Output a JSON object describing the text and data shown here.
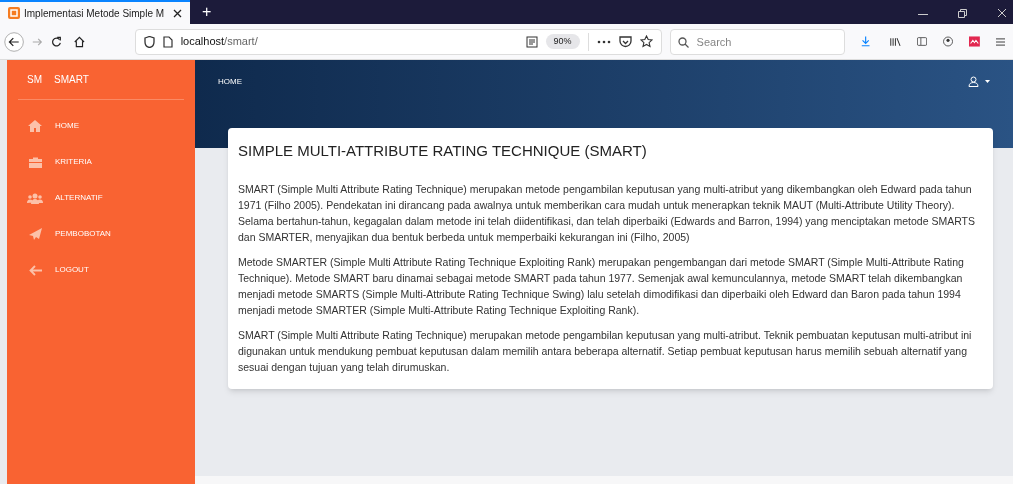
{
  "browser": {
    "tab_title": "Implementasi Metode Simple M",
    "new_tab": "+",
    "url_host": "localhost",
    "url_path": "/smart/",
    "zoom": "90%",
    "search_placeholder": "Search"
  },
  "sidebar": {
    "logo_mini": "SM",
    "logo_text": "SMART",
    "items": [
      {
        "label": "HOME",
        "kind": "home"
      },
      {
        "label": "KRITERIA",
        "kind": "briefcase"
      },
      {
        "label": "ALTERNATIF",
        "kind": "users"
      },
      {
        "label": "PEMBOBOTAN",
        "kind": "send"
      },
      {
        "label": "LOGOUT",
        "kind": "arrow"
      }
    ]
  },
  "navbar": {
    "title": "HOME"
  },
  "card": {
    "title": "SIMPLE MULTI-ATTRIBUTE RATING TECHNIQUE (SMART)",
    "paragraphs": [
      "SMART (Simple Multi Attribute Rating Technique) merupakan metode pengambilan keputusan yang multi-atribut yang dikembangkan oleh Edward pada tahun 1971 (Filho 2005). Pendekatan ini dirancang pada awalnya untuk memberikan cara mudah untuk menerapkan teknik MAUT (Multi-Attribute Utility Theory). Selama bertahun-tahun, kegagalan dalam metode ini telah diidentifikasi, dan telah diperbaiki (Edwards and Barron, 1994) yang menciptakan metode SMARTS dan SMARTER, menyajikan dua bentuk berbeda untuk memperbaiki kekurangan ini (Filho, 2005)",
      "Metode SMARTER (Simple Multi Attribute Rating Technique Exploiting Rank) merupakan pengembangan dari metode SMART (Simple Multi-Attribute Rating Technique). Metode SMART baru dinamai sebagai metode SMART pada tahun 1977. Semenjak awal kemunculannya, metode SMART telah dikembangkan menjadi metode SMARTS (Simple Multi-Attribute Rating Technique Swing) lalu setelah dimodifikasi dan diperbaiki oleh Edward dan Baron pada tahun 1994 menjadi metode SMARTER (Simple Multi-Attribute Rating Technique Exploiting Rank).",
      "SMART (Simple Multi Attribute Rating Technique) merupakan metode pengambilan keputusan yang multi-atribut. Teknik pembuatan keputusan multi-atribut ini digunakan untuk mendukung pembuat keputusan dalam memilih antara beberapa alternatif. Setiap pembuat keputusan harus memilih sebuah alternatif yang sesuai dengan tujuan yang telah dirumuskan."
    ]
  }
}
